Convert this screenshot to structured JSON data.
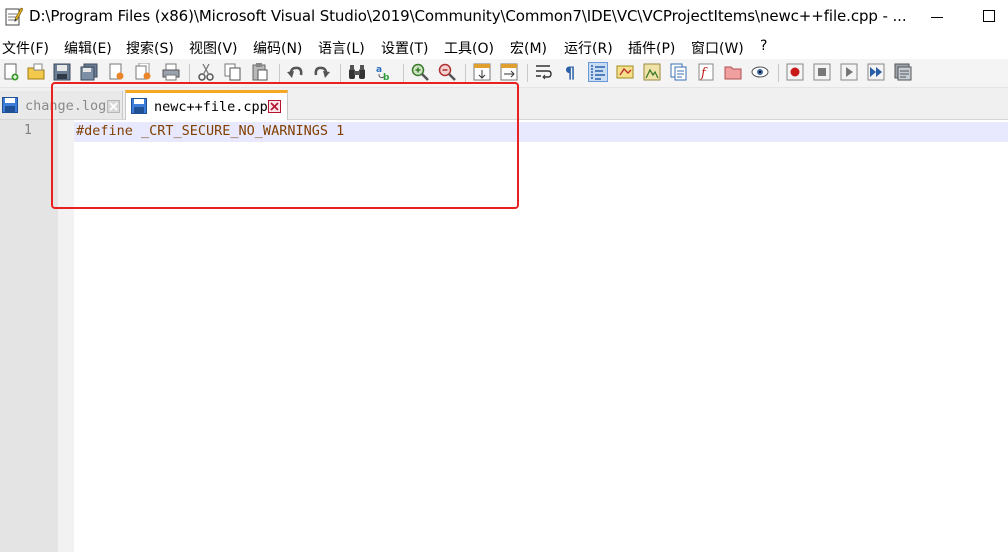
{
  "window": {
    "title": "D:\\Program Files (x86)\\Microsoft Visual Studio\\2019\\Community\\Common7\\IDE\\VC\\VCProjectItems\\newc++file.cpp - ..."
  },
  "menu": [
    {
      "label": "文件(F)"
    },
    {
      "label": "编辑(E)"
    },
    {
      "label": "搜索(S)"
    },
    {
      "label": "视图(V)"
    },
    {
      "label": "编码(N)"
    },
    {
      "label": "语言(L)"
    },
    {
      "label": "设置(T)"
    },
    {
      "label": "工具(O)"
    },
    {
      "label": "宏(M)"
    },
    {
      "label": "运行(R)"
    },
    {
      "label": "插件(P)"
    },
    {
      "label": "窗口(W)"
    },
    {
      "label": "?"
    }
  ],
  "tabs": [
    {
      "label": "change.log",
      "active": false
    },
    {
      "label": "newc++file.cpp",
      "active": true
    }
  ],
  "editor": {
    "lines": [
      {
        "number": "1",
        "text": "#define _CRT_SECURE_NO_WARNINGS 1"
      }
    ],
    "preprocessor_color": "#804000",
    "current_line_color": "#e8e8ff"
  },
  "colors": {
    "active_tab_accent": "#f5a623",
    "highlight_box": "#e8201f"
  }
}
